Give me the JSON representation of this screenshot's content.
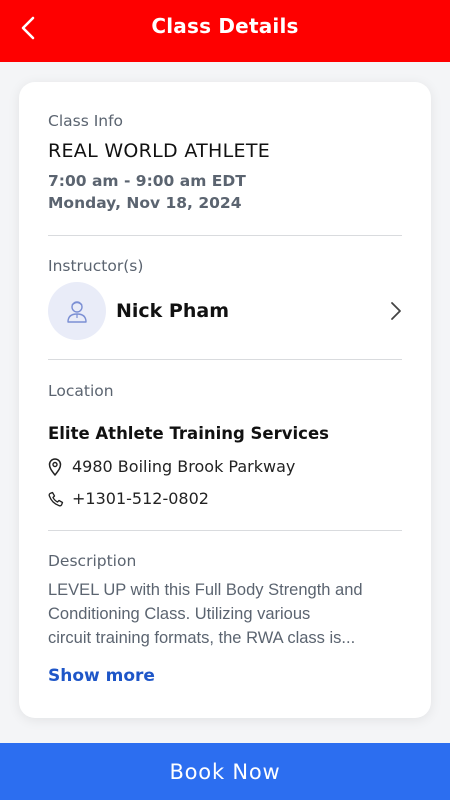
{
  "header": {
    "title": "Class Details",
    "background": "#fe0000"
  },
  "class_info": {
    "label": "Class Info",
    "name": "REAL WORLD ATHLETE",
    "time": "7:00 am - 9:00 am EDT",
    "date": "Monday, Nov 18, 2024"
  },
  "instructors": {
    "label": "Instructor(s)",
    "items": [
      {
        "name": "Nick Pham",
        "icon": "person-icon"
      }
    ]
  },
  "location": {
    "label": "Location",
    "name": "Elite Athlete Training Services",
    "address": "4980 Boiling Brook Parkway",
    "phone": "+1301-512-0802"
  },
  "description": {
    "label": "Description",
    "text": "LEVEL UP with this Full Body Strength and\nConditioning Class.  Utilizing various\ncircuit training formats, the RWA class is...",
    "show_more": "Show more"
  },
  "footer": {
    "book_label": "Book Now",
    "background": "#2c6ef0"
  }
}
